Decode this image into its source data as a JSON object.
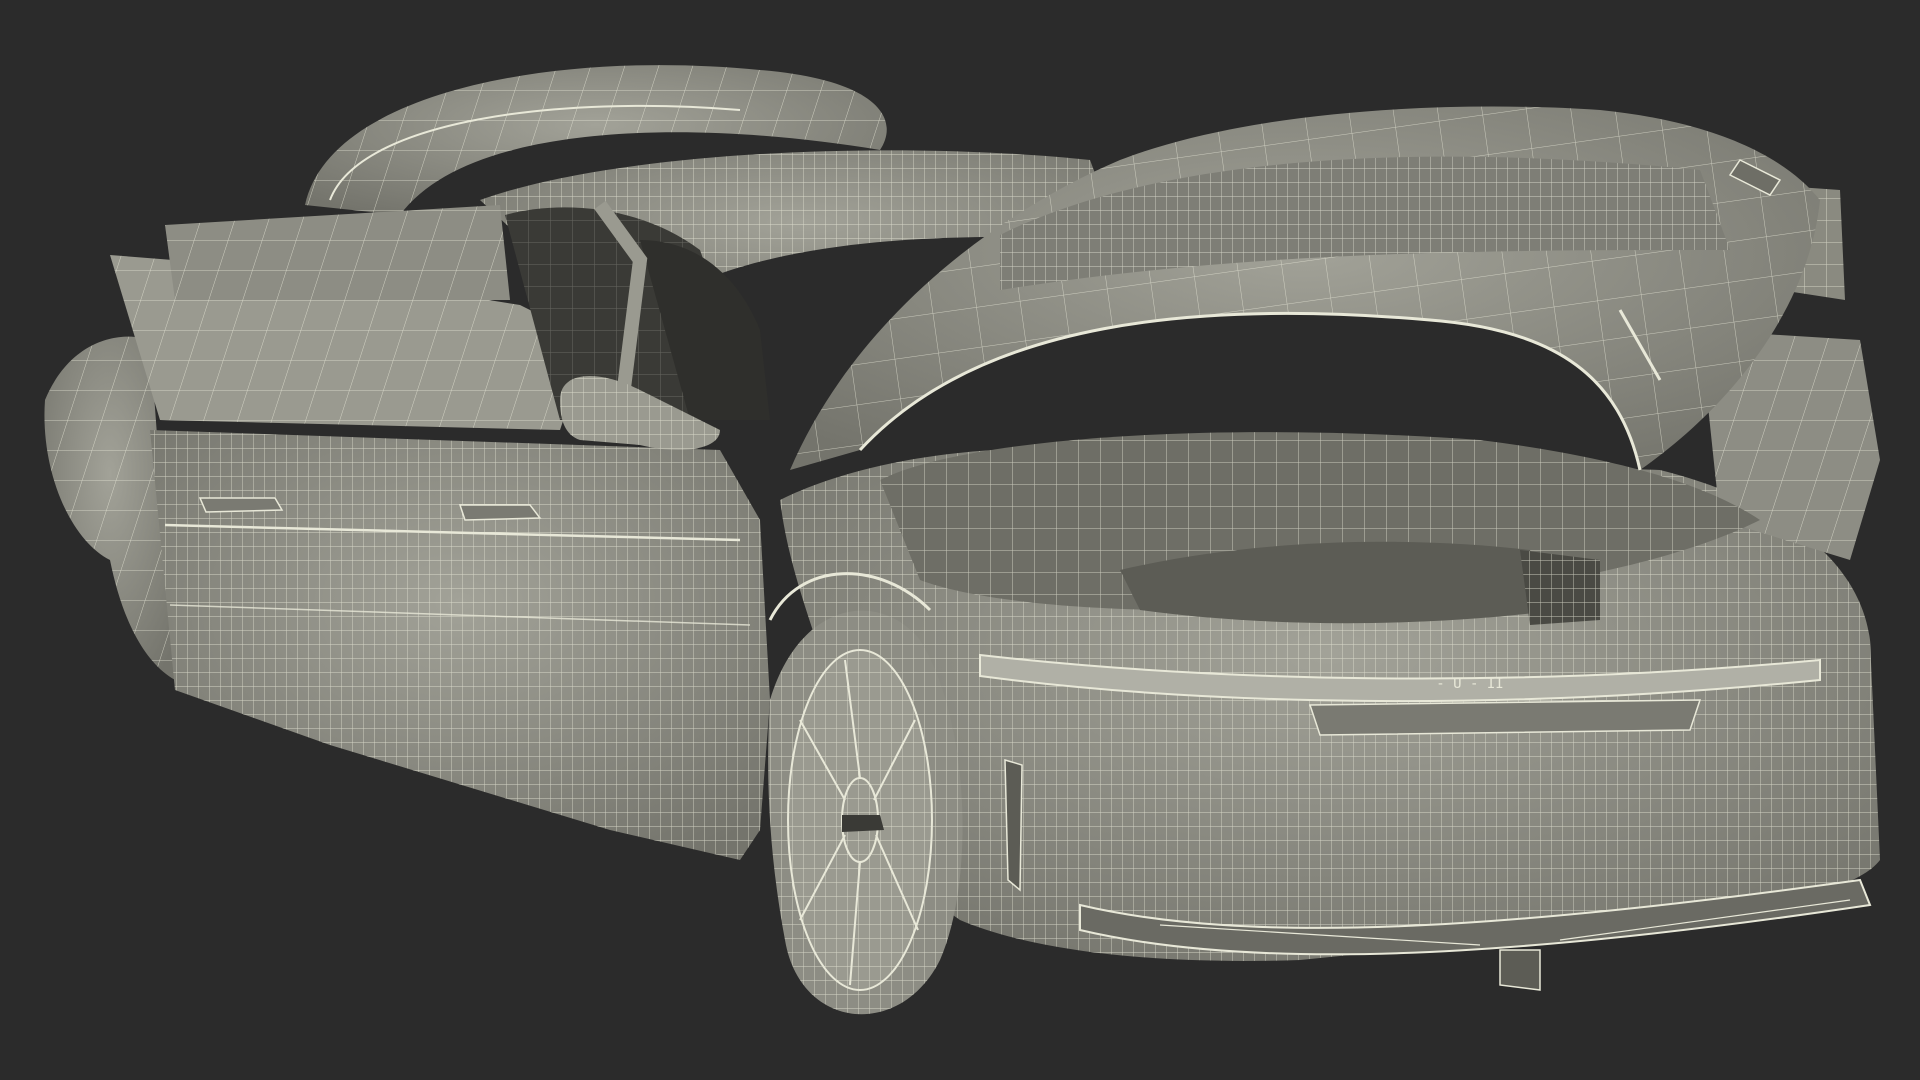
{
  "scene": {
    "subject_icon": "car-wireframe-icon",
    "colors": {
      "background": "#2b2b2b",
      "surface": "#8a8a80",
      "surface_light": "#9a9a90",
      "surface_dark": "#6e6e66",
      "interior": "#3a3a36",
      "wire": "#e8e8d8"
    },
    "front_badge": "- U - II"
  }
}
